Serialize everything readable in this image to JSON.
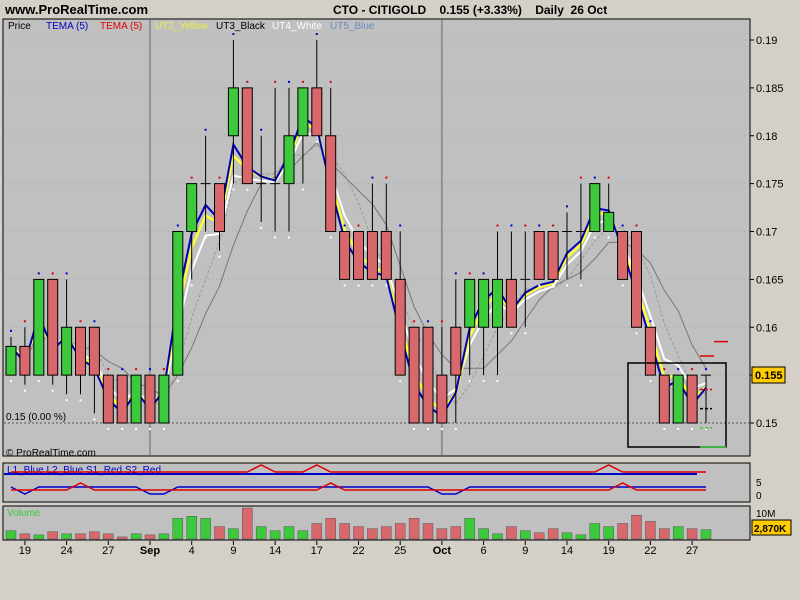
{
  "site": "www.ProRealTime.com",
  "header": {
    "symbol": "CTO - CITIGOLD",
    "price": "0.155 (+3.33%)",
    "period": "Daily  26 Oct"
  },
  "legend": {
    "price": "Price",
    "tema1": "TEMA (5)",
    "tema2": "TEMA (5)",
    "ut2": "UT2_Yellow",
    "ut3": "UT3_Black",
    "ut4": "UT4_White",
    "ut5": "UT5_Blue"
  },
  "ref_line_label": "0.15 (0.00 %)",
  "copyright": "© ProRealTime.com",
  "last_price_label": "0.155",
  "osc": {
    "legend": "L1_Blue L2_Blue S1_Red S2_Red",
    "ticks": [
      "5",
      "0"
    ]
  },
  "volume": {
    "label": "Volume",
    "ticks": [
      "10M"
    ],
    "last_value": "2,870K"
  },
  "colors": {
    "bg": "#c0c0c0",
    "up": "#3cc93c",
    "down": "#d9686c",
    "yellow": "#ffff33",
    "blue": "#0000bb",
    "white": "#ffffff"
  },
  "chart_data": {
    "type": "bar",
    "ylim": [
      0.146,
      0.192
    ],
    "yticks": [
      "0.19",
      "0.185",
      "0.18",
      "0.175",
      "0.17",
      "0.165",
      "0.16",
      "0.155",
      "0.15"
    ],
    "yticks_values": [
      0.19,
      0.185,
      0.18,
      0.175,
      0.17,
      0.165,
      0.16,
      0.155,
      0.15
    ],
    "xticks": [
      "19",
      "24",
      "27",
      "Sep",
      "4",
      "9",
      "14",
      "17",
      "22",
      "25",
      "Oct",
      "6",
      "9",
      "14",
      "19",
      "22",
      "27"
    ],
    "xticks_idx": [
      1,
      4,
      7,
      10,
      13,
      16,
      19,
      22,
      25,
      28,
      31,
      34,
      37,
      40,
      43,
      46,
      49
    ],
    "candles": [
      [
        0.155,
        0.158,
        0.159,
        0.155
      ],
      [
        0.158,
        0.155,
        0.16,
        0.154
      ],
      [
        0.155,
        0.165,
        0.165,
        0.155
      ],
      [
        0.165,
        0.155,
        0.165,
        0.154
      ],
      [
        0.155,
        0.16,
        0.165,
        0.153
      ],
      [
        0.16,
        0.155,
        0.16,
        0.153
      ],
      [
        0.16,
        0.155,
        0.16,
        0.151
      ],
      [
        0.155,
        0.15,
        0.155,
        0.15
      ],
      [
        0.155,
        0.15,
        0.155,
        0.15
      ],
      [
        0.15,
        0.155,
        0.155,
        0.15
      ],
      [
        0.155,
        0.15,
        0.155,
        0.15
      ],
      [
        0.15,
        0.155,
        0.155,
        0.15
      ],
      [
        0.155,
        0.17,
        0.17,
        0.155
      ],
      [
        0.17,
        0.175,
        0.175,
        0.165
      ],
      [
        0.175,
        0.175,
        0.18,
        0.17
      ],
      [
        0.175,
        0.17,
        0.175,
        0.168
      ],
      [
        0.18,
        0.185,
        0.19,
        0.175
      ],
      [
        0.185,
        0.175,
        0.185,
        0.175
      ],
      [
        0.175,
        0.175,
        0.18,
        0.171
      ],
      [
        0.175,
        0.175,
        0.185,
        0.17
      ],
      [
        0.175,
        0.18,
        0.185,
        0.17
      ],
      [
        0.18,
        0.185,
        0.185,
        0.175
      ],
      [
        0.185,
        0.18,
        0.19,
        0.18
      ],
      [
        0.18,
        0.17,
        0.185,
        0.17
      ],
      [
        0.17,
        0.165,
        0.17,
        0.165
      ],
      [
        0.17,
        0.165,
        0.17,
        0.165
      ],
      [
        0.17,
        0.165,
        0.175,
        0.165
      ],
      [
        0.17,
        0.165,
        0.175,
        0.165
      ],
      [
        0.165,
        0.155,
        0.17,
        0.155
      ],
      [
        0.16,
        0.15,
        0.16,
        0.15
      ],
      [
        0.16,
        0.15,
        0.16,
        0.15
      ],
      [
        0.155,
        0.15,
        0.16,
        0.15
      ],
      [
        0.16,
        0.155,
        0.165,
        0.15
      ],
      [
        0.16,
        0.165,
        0.165,
        0.155
      ],
      [
        0.16,
        0.165,
        0.165,
        0.155
      ],
      [
        0.16,
        0.165,
        0.17,
        0.155
      ],
      [
        0.165,
        0.16,
        0.17,
        0.16
      ],
      [
        0.165,
        0.165,
        0.17,
        0.16
      ],
      [
        0.17,
        0.165,
        0.17,
        0.165
      ],
      [
        0.17,
        0.165,
        0.17,
        0.165
      ],
      [
        0.17,
        0.17,
        0.172,
        0.165
      ],
      [
        0.17,
        0.17,
        0.175,
        0.165
      ],
      [
        0.17,
        0.175,
        0.175,
        0.17
      ],
      [
        0.17,
        0.172,
        0.175,
        0.17
      ],
      [
        0.17,
        0.165,
        0.17,
        0.165
      ],
      [
        0.17,
        0.16,
        0.17,
        0.16
      ],
      [
        0.16,
        0.155,
        0.16,
        0.155
      ],
      [
        0.155,
        0.15,
        0.155,
        0.15
      ],
      [
        0.15,
        0.155,
        0.155,
        0.15
      ],
      [
        0.155,
        0.15,
        0.155,
        0.15
      ],
      [
        0.155,
        0.155,
        0.155,
        0.15
      ]
    ],
    "volume": [
      8,
      5,
      4,
      7,
      5,
      5,
      7,
      5,
      2,
      5,
      4,
      5,
      20,
      22,
      20,
      12,
      10,
      30,
      12,
      8,
      12,
      8,
      15,
      20,
      15,
      12,
      10,
      12,
      15,
      20,
      15,
      10,
      12,
      20,
      10,
      5,
      12,
      8,
      6,
      10,
      6,
      4,
      15,
      12,
      15,
      23,
      17,
      10,
      12,
      10,
      9
    ],
    "volume_max": 30
  }
}
